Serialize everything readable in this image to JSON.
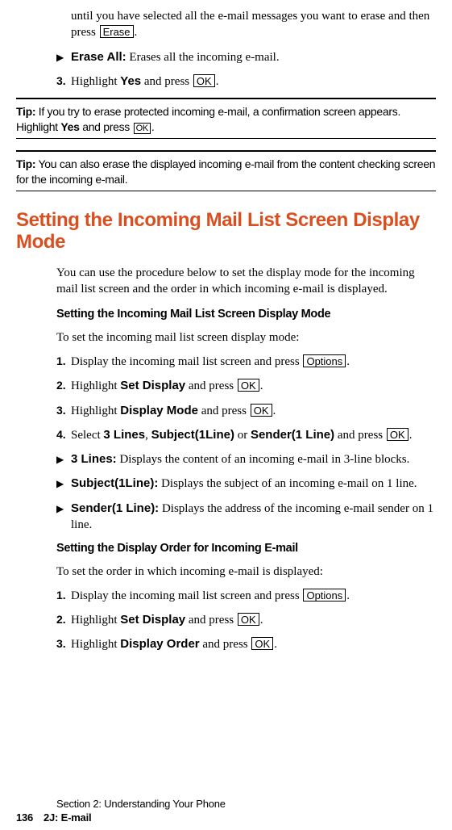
{
  "top": {
    "tail_text_a": "until you have selected all the e-mail messages you want to erase and then press ",
    "tail_key": "Erase",
    "tail_text_b": ".",
    "bullet_label": "Erase All:",
    "bullet_rest": " Erases all the incoming e-mail.",
    "step_num": "3.",
    "step_a": "Highlight ",
    "step_yes": "Yes",
    "step_b": " and press ",
    "step_key": "OK",
    "step_c": "."
  },
  "tip1": {
    "label": "Tip:",
    "a": " If you try to erase protected incoming e-mail, a confirmation screen appears. Highlight ",
    "yes": "Yes",
    "b": " and press ",
    "key": "OK",
    "c": "."
  },
  "tip2": {
    "label": "Tip:",
    "a": " You can also erase the displayed incoming e-mail from the content checking screen for the incoming e-mail."
  },
  "heading": "Setting the Incoming Mail List Screen Display Mode",
  "paragraph": "You can use the procedure below to set the display mode for the incoming mail list screen and the order in which incoming e-mail is displayed.",
  "sub1": {
    "title": "Setting the Incoming Mail List Screen Display Mode",
    "intro": "To set the incoming mail list screen display mode:",
    "s1": {
      "n": "1.",
      "a": "Display the incoming mail list screen and press ",
      "key": "Options",
      "b": "."
    },
    "s2": {
      "n": "2.",
      "a": "Highlight ",
      "strong": "Set Display",
      "b": " and press ",
      "key": "OK",
      "c": "."
    },
    "s3": {
      "n": "3.",
      "a": "Highlight ",
      "strong": "Display Mode",
      "b": " and press ",
      "key": "OK",
      "c": "."
    },
    "s4": {
      "n": "4.",
      "a": "Select ",
      "o1": "3 Lines",
      "sep1": ", ",
      "o2": "Subject(1Line)",
      "sep2": " or ",
      "o3": "Sender(1 Line)",
      "b": " and press ",
      "key": "OK",
      "c": "."
    },
    "b1": {
      "label": "3 Lines:",
      "rest": " Displays the content of an incoming e-mail in 3-line blocks."
    },
    "b2": {
      "label": "Subject(1Line):",
      "rest": " Displays the subject of an incoming e-mail on 1 line."
    },
    "b3": {
      "label": "Sender(1 Line):",
      "rest": " Displays the address of the incoming e-mail sender on 1 line."
    }
  },
  "sub2": {
    "title": "Setting the Display Order for Incoming E-mail",
    "intro": "To set the order in which incoming e-mail is displayed:",
    "s1": {
      "n": "1.",
      "a": "Display the incoming mail list screen and press ",
      "key": "Options",
      "b": "."
    },
    "s2": {
      "n": "2.",
      "a": "Highlight ",
      "strong": "Set Display",
      "b": " and press ",
      "key": "OK",
      "c": "."
    },
    "s3": {
      "n": "3.",
      "a": "Highlight ",
      "strong": "Display Order",
      "b": " and press ",
      "key": "OK",
      "c": "."
    }
  },
  "footer": {
    "ln1": "Section 2: Understanding Your Phone",
    "page": "136",
    "sect": "2J: E-mail"
  }
}
